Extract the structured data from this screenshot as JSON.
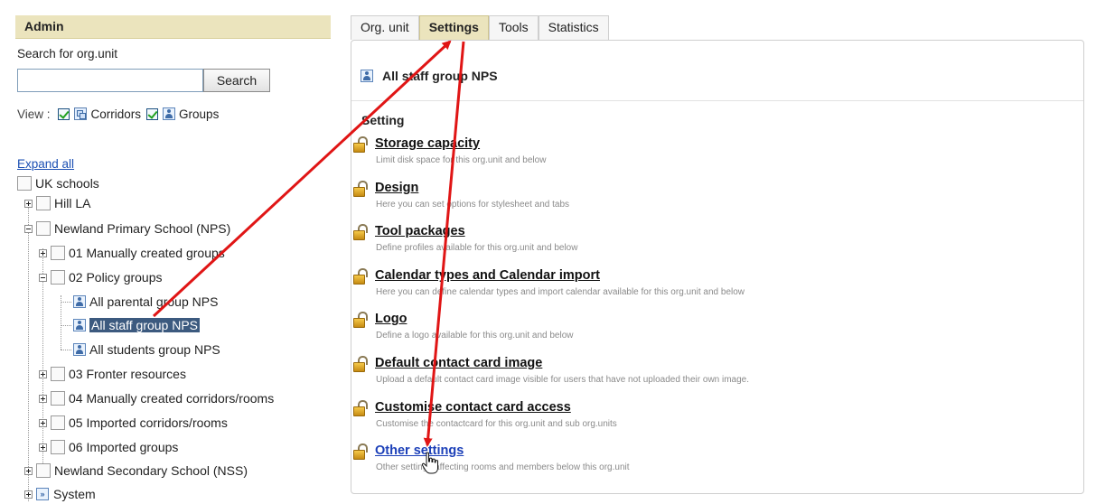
{
  "admin": {
    "header": "Admin",
    "search_label": "Search for org.unit",
    "search_value": "",
    "search_button": "Search",
    "view_label": "View :",
    "view_corridors": "Corridors",
    "view_groups": "Groups",
    "expand_all": "Expand all"
  },
  "tree": {
    "uk_schools": "UK schools",
    "hill_la": "Hill LA",
    "newland_primary": "Newland Primary School (NPS)",
    "manual_groups": "01 Manually created groups",
    "policy_groups": "02 Policy groups",
    "parental": "All parental group NPS",
    "staff": "All staff group NPS",
    "students": "All students group NPS",
    "fronter": "03 Fronter resources",
    "manual_corridors": "04 Manually created corridors/rooms",
    "imported_corridors": "05 Imported corridors/rooms",
    "imported_groups": "06 Imported groups",
    "newland_secondary": "Newland Secondary School (NSS)",
    "system": "System"
  },
  "tabs": [
    "Org. unit",
    "Settings",
    "Tools",
    "Statistics"
  ],
  "active_tab": "Settings",
  "content": {
    "unit_title": "All staff group NPS",
    "setting_heading": "Setting",
    "settings": [
      {
        "label": "Storage capacity",
        "desc": "Limit disk space for this org.unit and below"
      },
      {
        "label": "Design",
        "desc": "Here you can set options for stylesheet and tabs"
      },
      {
        "label": "Tool packages",
        "desc": "Define profiles available for this org.unit and below"
      },
      {
        "label": "Calendar types and Calendar import",
        "desc": "Here you can define calendar types and import calendar available for this org.unit and below"
      },
      {
        "label": "Logo",
        "desc": "Define a logo available for this org.unit and below"
      },
      {
        "label": "Default contact card image",
        "desc": "Upload a default contact card image visible for users that have not uploaded their own image."
      },
      {
        "label": "Customise contact card access",
        "desc": "Customise the contactcard for this org.unit and sub org.units"
      },
      {
        "label": "Other settings",
        "desc": "Other settings affecting rooms and members below this org.unit"
      }
    ]
  },
  "colors": {
    "header_bg": "#ebe4bd",
    "selected_bg": "#3c5a7f",
    "arrow": "#e01515",
    "link_blue": "#1b3fb8"
  }
}
